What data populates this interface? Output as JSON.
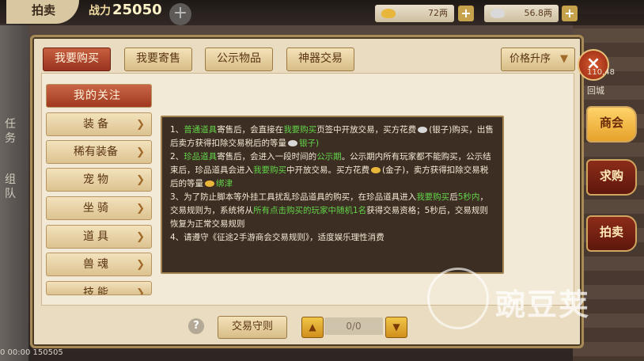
{
  "topbar": {
    "title": "拍卖",
    "power_label": "战力",
    "power_value": "25050",
    "plus": "+",
    "gold_amount": "72两",
    "silver_amount": "56.8两"
  },
  "tabs": [
    {
      "label": "我要购买",
      "active": true
    },
    {
      "label": "我要寄售",
      "active": false
    },
    {
      "label": "公示物品",
      "active": false
    },
    {
      "label": "神器交易",
      "active": false
    }
  ],
  "sort_label": "价格升序",
  "close_label": "×",
  "sidebar": [
    {
      "label": "我的关注",
      "active": true
    },
    {
      "label": "装备",
      "active": false
    },
    {
      "label": "稀有装备",
      "active": false
    },
    {
      "label": "宠物",
      "active": false
    },
    {
      "label": "坐骑",
      "active": false
    },
    {
      "label": "道具",
      "active": false
    },
    {
      "label": "兽魂",
      "active": false
    },
    {
      "label": "技能",
      "active": false
    }
  ],
  "tooltip": {
    "l1_a": "1、",
    "l1_g1": "普通道具",
    "l1_b": "寄售后，会直接在",
    "l1_g2": "我要购买",
    "l1_c": "页签中开放交易，买方花费",
    "l1_d": "(银子)购买，出售后卖方获得扣除交易税后的等量",
    "l1_e": "银子)",
    "l2_a": "2、",
    "l2_g1": "珍品道具",
    "l2_b": "寄售后，会进入一段时间的",
    "l2_g2": "公示期",
    "l2_c": "。公示期内所有玩家都不能购买，公示结束后，珍品道具会进入",
    "l2_g3": "我要购买",
    "l2_d": "中开放交易。买方花费",
    "l2_e": "(金子)，卖方获得扣除交易税后的等量",
    "l2_f": "绑津",
    "l3_a": "3、为了防止脚本等外挂工具扰乱珍品道具的购买，在珍品道具进入",
    "l3_g1": "我要购买",
    "l3_b": "后",
    "l3_g2": "5秒内",
    "l3_c": "，交易规则为，系统将从",
    "l3_g3": "所有点击购买的玩家中随机1名",
    "l3_d": "获得交易资格；5秒后，交易规则恢复为正常交易规则",
    "l4": "4、请遵守《征途2手游商会交易规则》，适度娱乐理性消费"
  },
  "bottom": {
    "help": "?",
    "rules_label": "交易守则",
    "prev_icon": "up-triangle-icon",
    "next_icon": "down-triangle-icon",
    "page_text": "0/0"
  },
  "right_buttons": [
    {
      "label": "商会",
      "active": true
    },
    {
      "label": "求购",
      "active": false
    },
    {
      "label": "拍卖",
      "active": false
    }
  ],
  "right_info": {
    "coord": "110,48",
    "city": "回城"
  },
  "left_tabs": [
    "任务",
    "组队"
  ],
  "watermark": "豌豆荚",
  "chat_text": "0 00:00 150505"
}
